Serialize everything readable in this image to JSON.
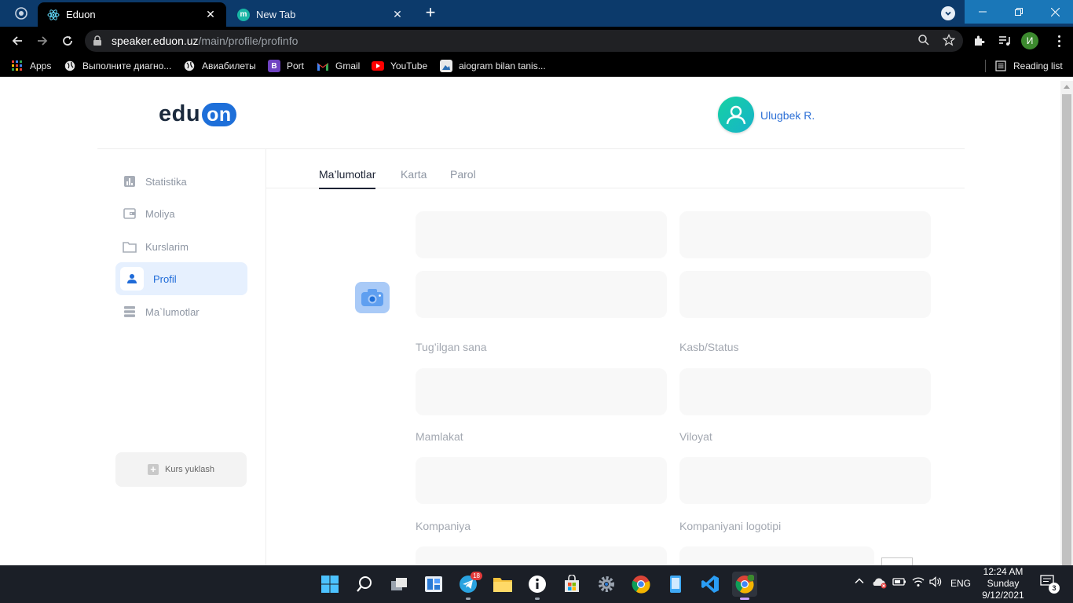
{
  "browser": {
    "tabs": [
      {
        "title": "Eduon",
        "active": true
      },
      {
        "title": "New Tab",
        "active": false
      }
    ],
    "url_host": "speaker.eduon.uz",
    "url_path": "/main/profile/profinfo",
    "profile_initial": "И",
    "bookmarks": [
      {
        "label": "Apps",
        "icon": "apps-grid-icon"
      },
      {
        "label": "Выполните диагно...",
        "icon": "globe-icon"
      },
      {
        "label": "Авиабилеты",
        "icon": "globe-icon"
      },
      {
        "label": "Port",
        "icon": "bootstrap-icon"
      },
      {
        "label": "Gmail",
        "icon": "gmail-icon"
      },
      {
        "label": "YouTube",
        "icon": "youtube-icon"
      },
      {
        "label": "aiogram bilan tanis...",
        "icon": "image-icon"
      }
    ],
    "reading_list": "Reading list"
  },
  "header": {
    "logo_text": "edu",
    "logo_highlight": "on",
    "user_name": "Ulugbek R."
  },
  "sidebar": {
    "items": [
      {
        "label": "Statistika",
        "icon": "bar-chart-icon",
        "active": false
      },
      {
        "label": "Moliya",
        "icon": "wallet-icon",
        "active": false
      },
      {
        "label": "Kurslarim",
        "icon": "folder-icon",
        "active": false
      },
      {
        "label": "Profil",
        "icon": "user-icon",
        "active": true
      },
      {
        "label": "Ma`lumotlar",
        "icon": "list-icon",
        "active": false
      }
    ],
    "upload_label": "Kurs yuklash"
  },
  "profile_tabs": [
    {
      "label": "Ma’lumotlar",
      "active": true
    },
    {
      "label": "Karta",
      "active": false
    },
    {
      "label": "Parol",
      "active": false
    }
  ],
  "form": {
    "labels": {
      "birth_date": "Tug’ilgan sana",
      "profession": "Kasb/Status",
      "country": "Mamlakat",
      "region": "Viloyat",
      "company": "Kompaniya",
      "company_logo": "Kompaniyani logotipi"
    }
  },
  "taskbar": {
    "telegram_badge": "18",
    "tray_lang": "ENG",
    "time": "12:24 AM",
    "day": "Sunday",
    "date": "9/12/2021",
    "notifications": "3"
  },
  "colors": {
    "brand": "#1e6fd9",
    "active_bg": "#e6f0fe",
    "field_bg": "#f8f8f8",
    "label_gray": "#a3a8b1"
  }
}
